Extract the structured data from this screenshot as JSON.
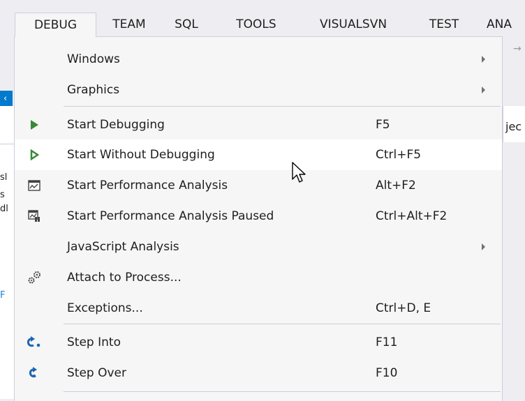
{
  "menubar": {
    "items": [
      {
        "label": "DEBUG",
        "open": true
      },
      {
        "label": "TEAM"
      },
      {
        "label": "SQL"
      },
      {
        "label": "TOOLS"
      },
      {
        "label": "VISUALSVN"
      },
      {
        "label": "TEST"
      },
      {
        "label": "ANA"
      }
    ]
  },
  "background": {
    "right_fragment": "jec",
    "left_fragments": [
      "sl",
      "s",
      "dl",
      "F"
    ]
  },
  "menu": {
    "items": [
      {
        "label": "Windows",
        "shortcut": "",
        "submenu": true,
        "icon": ""
      },
      {
        "label": "Graphics",
        "shortcut": "",
        "submenu": true,
        "icon": ""
      },
      {
        "label": "Start Debugging",
        "shortcut": "F5",
        "icon": "play-green-icon"
      },
      {
        "label": "Start Without Debugging",
        "shortcut": "Ctrl+F5",
        "icon": "play-outline-green-icon",
        "hovered": true
      },
      {
        "label": "Start Performance Analysis",
        "shortcut": "Alt+F2",
        "icon": "performance-icon"
      },
      {
        "label": "Start Performance Analysis Paused",
        "shortcut": "Ctrl+Alt+F2",
        "icon": "performance-paused-icon"
      },
      {
        "label": "JavaScript Analysis",
        "shortcut": "",
        "submenu": true,
        "icon": ""
      },
      {
        "label": "Attach to Process...",
        "shortcut": "",
        "icon": "attach-gears-icon"
      },
      {
        "label": "Exceptions...",
        "shortcut": "Ctrl+D, E",
        "icon": ""
      },
      {
        "label": "Step Into",
        "shortcut": "F11",
        "icon": "step-into-icon"
      },
      {
        "label": "Step Over",
        "shortcut": "F10",
        "icon": "step-over-icon"
      }
    ]
  },
  "colors": {
    "accent": "#007acc",
    "play_green": "#388a34",
    "step_blue": "#1c66b0",
    "menu_bg": "#f6f6f6",
    "hover_bg": "#ffffff"
  }
}
